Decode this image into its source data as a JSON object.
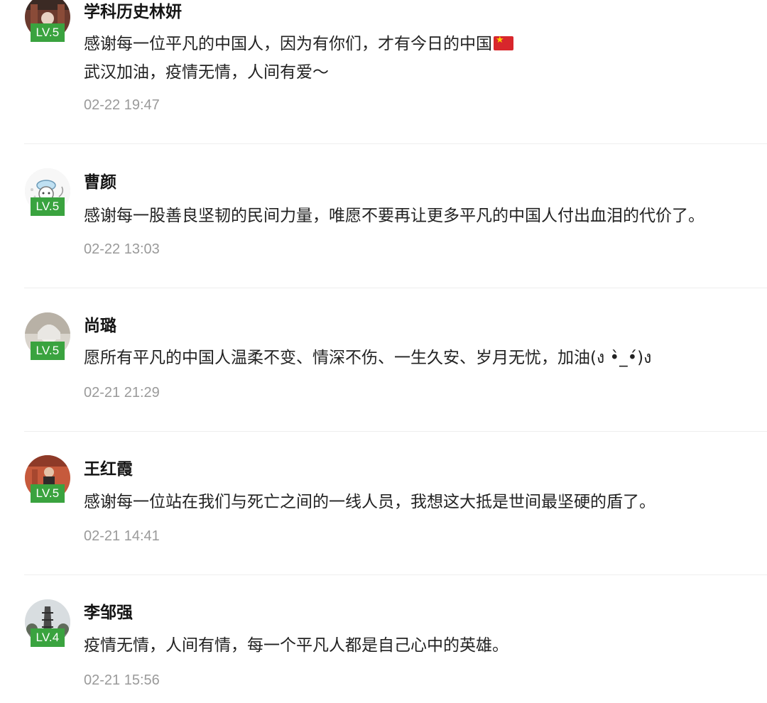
{
  "comments": [
    {
      "name": "学科历史林妍",
      "level": "LV.5",
      "avatar_icon": "user-avatar-photo",
      "lines": [
        "感谢每一位平凡的中国人，因为有你们，才有今日的中国",
        "武汉加油，疫情无情，人间有爱～"
      ],
      "flag_icon": "china-flag-icon",
      "time": "02-22 19:47"
    },
    {
      "name": "曹颜",
      "level": "LV.5",
      "avatar_icon": "user-avatar-cartoon",
      "lines": [
        "感谢每一股善良坚韧的民间力量，唯愿不要再让更多平凡的中国人付出血泪的代价了。"
      ],
      "time": "02-22 13:03"
    },
    {
      "name": "尚璐",
      "level": "LV.5",
      "avatar_icon": "user-avatar-photo",
      "lines": [
        "愿所有平凡的中国人温柔不变、情深不伤、一生久安、岁月无忧，加油(ง •̀_•́)ง"
      ],
      "time": "02-21 21:29"
    },
    {
      "name": "王红霞",
      "level": "LV.5",
      "avatar_icon": "user-avatar-photo",
      "lines": [
        "感谢每一位站在我们与死亡之间的一线人员，我想这大抵是世间最坚硬的盾了。"
      ],
      "time": "02-21 14:41"
    },
    {
      "name": "李邹强",
      "level": "LV.4",
      "avatar_icon": "user-avatar-photo",
      "lines": [
        "疫情无情，人间有情，每一个平凡人都是自己心中的英雄。"
      ],
      "time": "02-21 15:56"
    }
  ],
  "colors": {
    "level_badge": "#3aa33f",
    "timestamp": "#9a9a9a",
    "divider": "#eeeeee"
  }
}
